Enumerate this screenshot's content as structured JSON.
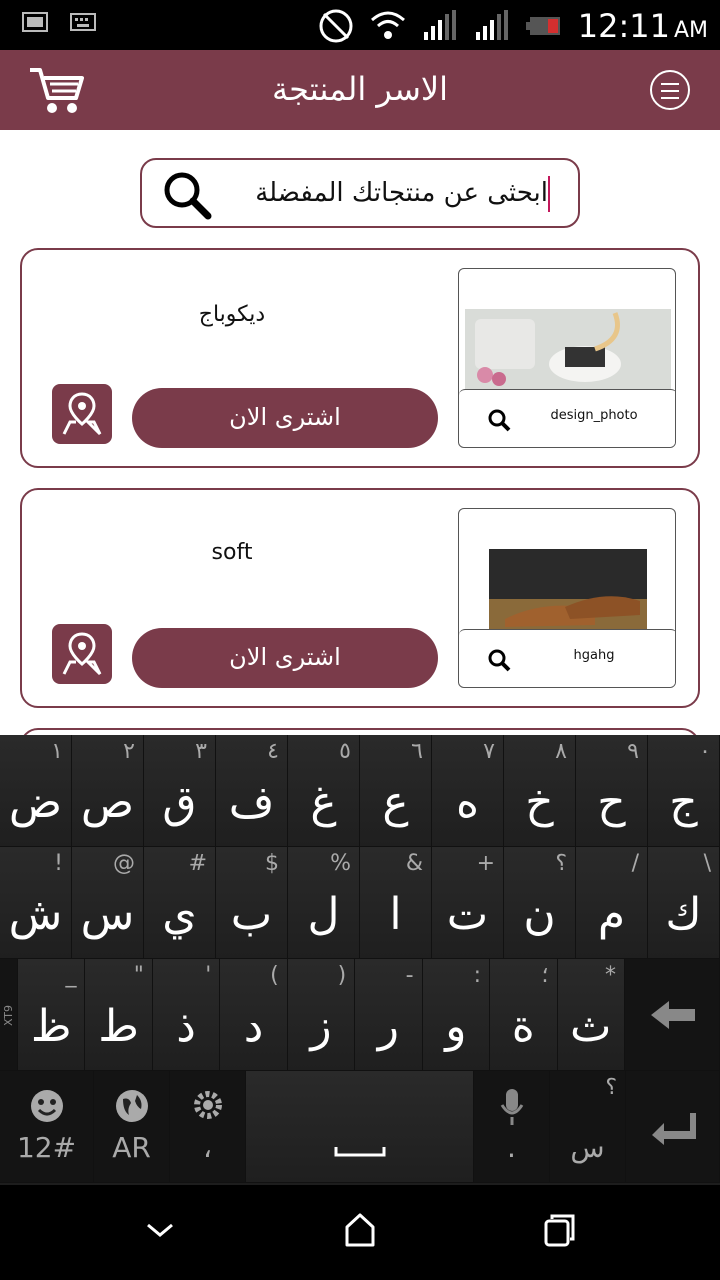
{
  "status_bar": {
    "time": "12:11",
    "ampm": "AM"
  },
  "header": {
    "title": "الاسر المنتجة"
  },
  "search": {
    "text": "ابحثى عن منتجاتك المفضلة"
  },
  "cards": [
    {
      "name": "ديكوباج",
      "buy_label": "اشترى الان",
      "thumb_caption": "design_photo"
    },
    {
      "name": "soft",
      "buy_label": "اشترى الان",
      "thumb_caption": "hgahg"
    }
  ],
  "keyboard": {
    "row1": [
      {
        "hint": "١",
        "char": "ض"
      },
      {
        "hint": "٢",
        "char": "ص"
      },
      {
        "hint": "٣",
        "char": "ق"
      },
      {
        "hint": "٤",
        "char": "ف"
      },
      {
        "hint": "٥",
        "char": "غ"
      },
      {
        "hint": "٦",
        "char": "ع"
      },
      {
        "hint": "٧",
        "char": "ه"
      },
      {
        "hint": "٨",
        "char": "خ"
      },
      {
        "hint": "٩",
        "char": "ح"
      },
      {
        "hint": "٠",
        "char": "ج"
      }
    ],
    "row2": [
      {
        "hint": "!",
        "char": "ش"
      },
      {
        "hint": "@",
        "char": "س"
      },
      {
        "hint": "#",
        "char": "ي"
      },
      {
        "hint": "$",
        "char": "ب"
      },
      {
        "hint": "%",
        "char": "ل"
      },
      {
        "hint": "&",
        "char": "ا"
      },
      {
        "hint": "+",
        "char": "ت"
      },
      {
        "hint": "؟",
        "char": "ن"
      },
      {
        "hint": "/",
        "char": "م"
      },
      {
        "hint": "\\",
        "char": "ك"
      }
    ],
    "row3": [
      {
        "hint": "_",
        "char": "ظ"
      },
      {
        "hint": "\"",
        "char": "ط"
      },
      {
        "hint": "'",
        "char": "ذ"
      },
      {
        "hint": "(",
        "char": "د"
      },
      {
        "hint": ")",
        "char": "ز"
      },
      {
        "hint": "-",
        "char": "ر"
      },
      {
        "hint": ":",
        "char": "و"
      },
      {
        "hint": "؛",
        "char": "ة"
      },
      {
        "hint": "*",
        "char": "ث"
      }
    ],
    "xt9": "XT9",
    "symbols_label": "12#",
    "lang_label": "AR",
    "comma": "،",
    "period": ".",
    "extra_hint": "؟",
    "extra_char": "س"
  }
}
